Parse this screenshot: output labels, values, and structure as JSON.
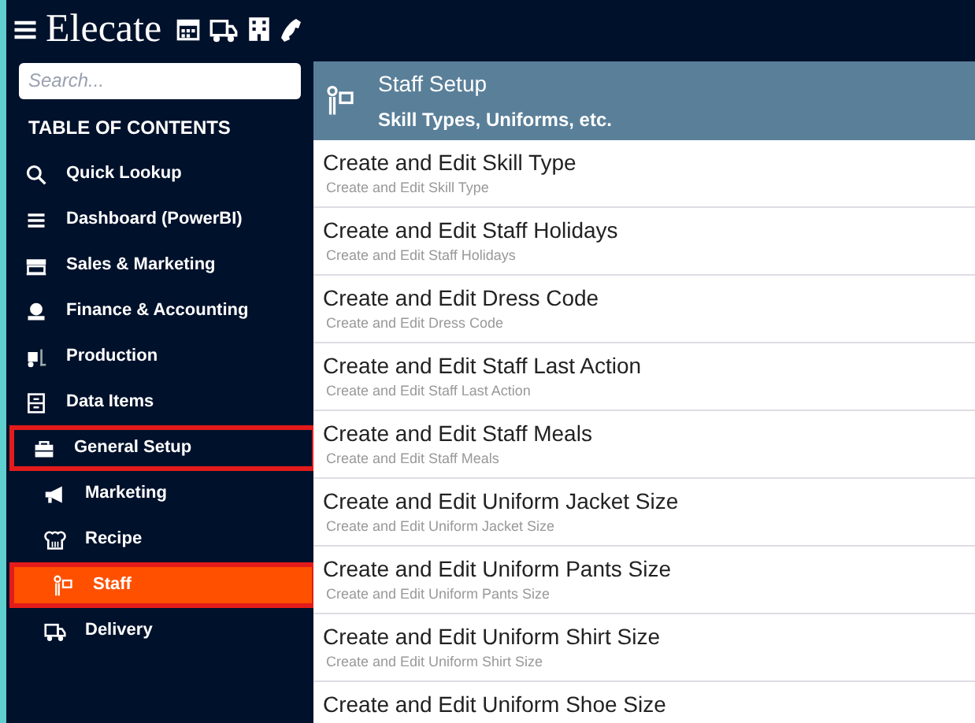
{
  "header": {
    "logo": "Elecate"
  },
  "search": {
    "placeholder": "Search..."
  },
  "toc_title": "TABLE OF CONTENTS",
  "nav": [
    {
      "label": "Quick Lookup",
      "selected": false,
      "highlighted": false
    },
    {
      "label": "Dashboard (PowerBI)",
      "selected": false,
      "highlighted": false
    },
    {
      "label": "Sales & Marketing",
      "selected": false,
      "highlighted": false
    },
    {
      "label": "Finance & Accounting",
      "selected": false,
      "highlighted": false
    },
    {
      "label": "Production",
      "selected": false,
      "highlighted": false
    },
    {
      "label": "Data Items",
      "selected": false,
      "highlighted": false
    },
    {
      "label": "General Setup",
      "selected": false,
      "highlighted": true,
      "children": [
        {
          "label": "Marketing",
          "selected": false,
          "highlighted": false
        },
        {
          "label": "Recipe",
          "selected": false,
          "highlighted": false
        },
        {
          "label": "Staff",
          "selected": true,
          "highlighted": true
        },
        {
          "label": "Delivery",
          "selected": false,
          "highlighted": false
        }
      ]
    }
  ],
  "panel": {
    "title": "Staff Setup",
    "subtitle": "Skill Types, Uniforms, etc."
  },
  "items": [
    {
      "title": "Create and Edit Skill Type",
      "subtitle": "Create and Edit Skill Type"
    },
    {
      "title": "Create and Edit Staff Holidays",
      "subtitle": "Create and Edit Staff Holidays"
    },
    {
      "title": "Create and Edit Dress Code",
      "subtitle": "Create and Edit Dress Code"
    },
    {
      "title": "Create and Edit Staff Last Action",
      "subtitle": "Create and Edit Staff Last Action"
    },
    {
      "title": "Create and Edit Staff Meals",
      "subtitle": "Create and Edit Staff Meals"
    },
    {
      "title": "Create and Edit Uniform Jacket Size",
      "subtitle": "Create and Edit Uniform Jacket Size"
    },
    {
      "title": "Create and Edit Uniform Pants Size",
      "subtitle": "Create and Edit Uniform Pants Size"
    },
    {
      "title": "Create and Edit Uniform Shirt Size",
      "subtitle": "Create and Edit Uniform Shirt Size"
    },
    {
      "title": "Create and Edit Uniform Shoe Size"
    }
  ]
}
